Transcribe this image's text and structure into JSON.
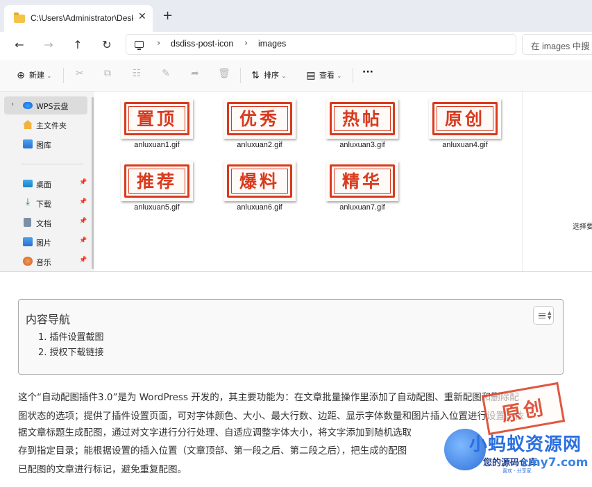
{
  "explorer": {
    "tab_title": "C:\\Users\\Administrator\\Desktop",
    "tab_close": "✕",
    "new_tab": "+",
    "breadcrumb": [
      "dsdiss-post-icon",
      "images"
    ],
    "search_placeholder": "在 images 中搜",
    "toolbar": {
      "new_label": "新建",
      "sort_label": "排序",
      "view_label": "查看",
      "more_label": "···"
    },
    "sidebar": {
      "cloud": "WPS云盘",
      "home": "主文件夹",
      "gallery": "图库",
      "pinned": [
        "桌面",
        "下载",
        "文档",
        "图片",
        "音乐"
      ]
    },
    "files": [
      {
        "name": "anluxuan1.gif",
        "stamp": "置顶"
      },
      {
        "name": "anluxuan2.gif",
        "stamp": "优秀"
      },
      {
        "name": "anluxuan3.gif",
        "stamp": "热帖"
      },
      {
        "name": "anluxuan4.gif",
        "stamp": "原创"
      },
      {
        "name": "anluxuan5.gif",
        "stamp": "推荐"
      },
      {
        "name": "anluxuan6.gif",
        "stamp": "爆料"
      },
      {
        "name": "anluxuan7.gif",
        "stamp": "精华"
      }
    ],
    "detail_text": "选择要",
    "colors": {
      "stamp_red": "#d93a1e",
      "folder": "#f4c44a"
    }
  },
  "article": {
    "toc_title": "内容导航",
    "toc_items": [
      "1. 插件设置截图",
      "2. 授权下载链接"
    ],
    "paragraph_lines": [
      "这个“自动配图插件3.0”是为 WordPress 开发的，其主要功能为：在文章批量操作里添加了自动配图、重新配图和删除配",
      "图状态的选项；提供了插件设置页面，可对字体颜色、大小、最大行数、边距、显示字体数量和图片插入位置进行设置；依",
      "据文章标题生成配图，通过对文字进行分行处理、自适应调整字体大小，将文字添加到随机选取",
      "存到指定目录；能根据设置的插入位置（文章顶部、第一段之后、第二段之后），把生成的配图",
      "已配图的文章进行标记，避免重复配图。"
    ]
  },
  "watermark": {
    "stamp": "原创",
    "big": "小蚂蚁资源网",
    "sub": "您的源码仓库",
    "url": "xmy7.com",
    "tiny": "喜欢 · 分享家"
  }
}
